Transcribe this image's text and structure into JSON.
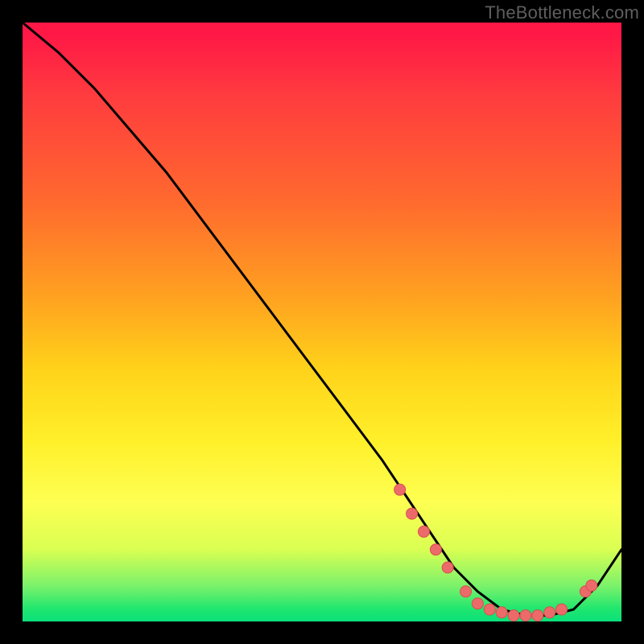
{
  "watermark": "TheBottleneck.com",
  "colors": {
    "curve_stroke": "#000000",
    "marker_fill": "#ec6a6a",
    "marker_stroke": "#d94f4f"
  },
  "chart_data": {
    "type": "line",
    "title": "",
    "xlabel": "",
    "ylabel": "",
    "xlim": [
      0,
      100
    ],
    "ylim": [
      0,
      100
    ],
    "series": [
      {
        "name": "bottleneck-curve",
        "x": [
          0,
          6,
          12,
          18,
          24,
          30,
          36,
          42,
          48,
          54,
          60,
          64,
          68,
          72,
          76,
          80,
          84,
          88,
          92,
          96,
          100
        ],
        "y": [
          100,
          95,
          89,
          82,
          75,
          67,
          59,
          51,
          43,
          35,
          27,
          21,
          15,
          9,
          5,
          2,
          1,
          1,
          2,
          6,
          12
        ]
      }
    ],
    "markers": [
      {
        "x": 63,
        "y": 22
      },
      {
        "x": 65,
        "y": 18
      },
      {
        "x": 67,
        "y": 15
      },
      {
        "x": 69,
        "y": 12
      },
      {
        "x": 71,
        "y": 9
      },
      {
        "x": 74,
        "y": 5
      },
      {
        "x": 76,
        "y": 3
      },
      {
        "x": 78,
        "y": 2
      },
      {
        "x": 80,
        "y": 1.5
      },
      {
        "x": 82,
        "y": 1
      },
      {
        "x": 84,
        "y": 1
      },
      {
        "x": 86,
        "y": 1
      },
      {
        "x": 88,
        "y": 1.5
      },
      {
        "x": 90,
        "y": 2
      },
      {
        "x": 94,
        "y": 5
      },
      {
        "x": 95,
        "y": 6
      }
    ]
  }
}
